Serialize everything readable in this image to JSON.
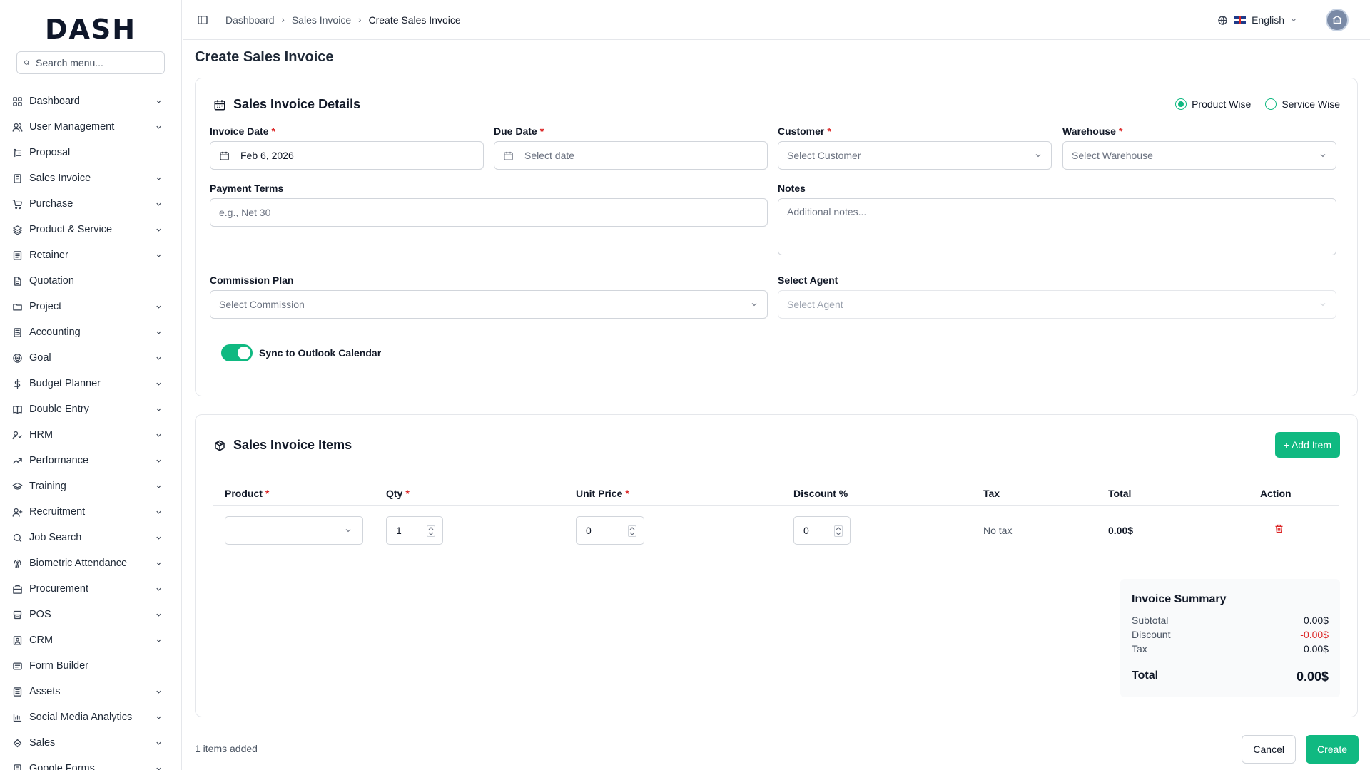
{
  "brand": {
    "logo_text": "DASH"
  },
  "search": {
    "placeholder": "Search menu..."
  },
  "sidebar": {
    "items": [
      {
        "label": "Dashboard",
        "icon": "grid-icon",
        "chevron": true
      },
      {
        "label": "User Management",
        "icon": "users-icon",
        "chevron": true
      },
      {
        "label": "Proposal",
        "icon": "proposal-icon",
        "chevron": false
      },
      {
        "label": "Sales Invoice",
        "icon": "invoice-icon",
        "chevron": true
      },
      {
        "label": "Purchase",
        "icon": "cart-icon",
        "chevron": true
      },
      {
        "label": "Product & Service",
        "icon": "layers-icon",
        "chevron": true
      },
      {
        "label": "Retainer",
        "icon": "retainer-icon",
        "chevron": true
      },
      {
        "label": "Quotation",
        "icon": "document-icon",
        "chevron": false
      },
      {
        "label": "Project",
        "icon": "folder-icon",
        "chevron": true
      },
      {
        "label": "Accounting",
        "icon": "calculator-icon",
        "chevron": true
      },
      {
        "label": "Goal",
        "icon": "target-icon",
        "chevron": true
      },
      {
        "label": "Budget Planner",
        "icon": "dollar-icon",
        "chevron": true
      },
      {
        "label": "Double Entry",
        "icon": "book-icon",
        "chevron": true
      },
      {
        "label": "HRM",
        "icon": "hrm-icon",
        "chevron": true
      },
      {
        "label": "Performance",
        "icon": "trending-icon",
        "chevron": true
      },
      {
        "label": "Training",
        "icon": "graduation-icon",
        "chevron": true
      },
      {
        "label": "Recruitment",
        "icon": "recruit-icon",
        "chevron": true
      },
      {
        "label": "Job Search",
        "icon": "search-icon",
        "chevron": true
      },
      {
        "label": "Biometric Attendance",
        "icon": "fingerprint-icon",
        "chevron": true
      },
      {
        "label": "Procurement",
        "icon": "procurement-icon",
        "chevron": true
      },
      {
        "label": "POS",
        "icon": "pos-icon",
        "chevron": true
      },
      {
        "label": "CRM",
        "icon": "crm-icon",
        "chevron": true
      },
      {
        "label": "Form Builder",
        "icon": "form-icon",
        "chevron": false
      },
      {
        "label": "Assets",
        "icon": "assets-icon",
        "chevron": true
      },
      {
        "label": "Social Media Analytics",
        "icon": "chart-icon",
        "chevron": true
      },
      {
        "label": "Sales",
        "icon": "sales-icon",
        "chevron": true
      },
      {
        "label": "Google Forms",
        "icon": "google-forms-icon",
        "chevron": true
      }
    ]
  },
  "breadcrumb": {
    "items": [
      "Dashboard",
      "Sales Invoice",
      "Create Sales Invoice"
    ]
  },
  "header": {
    "language": "English"
  },
  "page": {
    "title": "Create Sales Invoice"
  },
  "details": {
    "title": "Sales Invoice Details",
    "type_options": [
      "Product Wise",
      "Service Wise"
    ],
    "type_selected": "Product Wise",
    "invoice_date": {
      "label": "Invoice Date",
      "value": "Feb 6, 2026"
    },
    "due_date": {
      "label": "Due Date",
      "placeholder": "Select date"
    },
    "customer": {
      "label": "Customer",
      "placeholder": "Select Customer"
    },
    "warehouse": {
      "label": "Warehouse",
      "placeholder": "Select Warehouse"
    },
    "payment_terms": {
      "label": "Payment Terms",
      "placeholder": "e.g., Net 30"
    },
    "notes": {
      "label": "Notes",
      "placeholder": "Additional notes..."
    },
    "commission": {
      "label": "Commission Plan",
      "placeholder": "Select Commission"
    },
    "agent": {
      "label": "Select Agent",
      "placeholder": "Select Agent"
    },
    "sync": {
      "label": "Sync to Outlook Calendar",
      "enabled": true
    }
  },
  "items": {
    "title": "Sales Invoice Items",
    "add_label": "+ Add Item",
    "columns": {
      "product": "Product",
      "qty": "Qty",
      "unit_price": "Unit Price",
      "discount": "Discount %",
      "tax": "Tax",
      "total": "Total",
      "action": "Action"
    },
    "rows": [
      {
        "product": "",
        "qty": "1",
        "unit_price": "0",
        "discount": "0",
        "tax": "No tax",
        "total": "0.00$"
      }
    ]
  },
  "summary": {
    "title": "Invoice Summary",
    "subtotal_label": "Subtotal",
    "subtotal": "0.00$",
    "discount_label": "Discount",
    "discount": "-0.00$",
    "tax_label": "Tax",
    "tax": "0.00$",
    "total_label": "Total",
    "total": "0.00$"
  },
  "footer": {
    "count_text": "1 items added",
    "cancel": "Cancel",
    "create": "Create"
  },
  "colors": {
    "accent": "#10b981",
    "danger": "#dc2626"
  }
}
